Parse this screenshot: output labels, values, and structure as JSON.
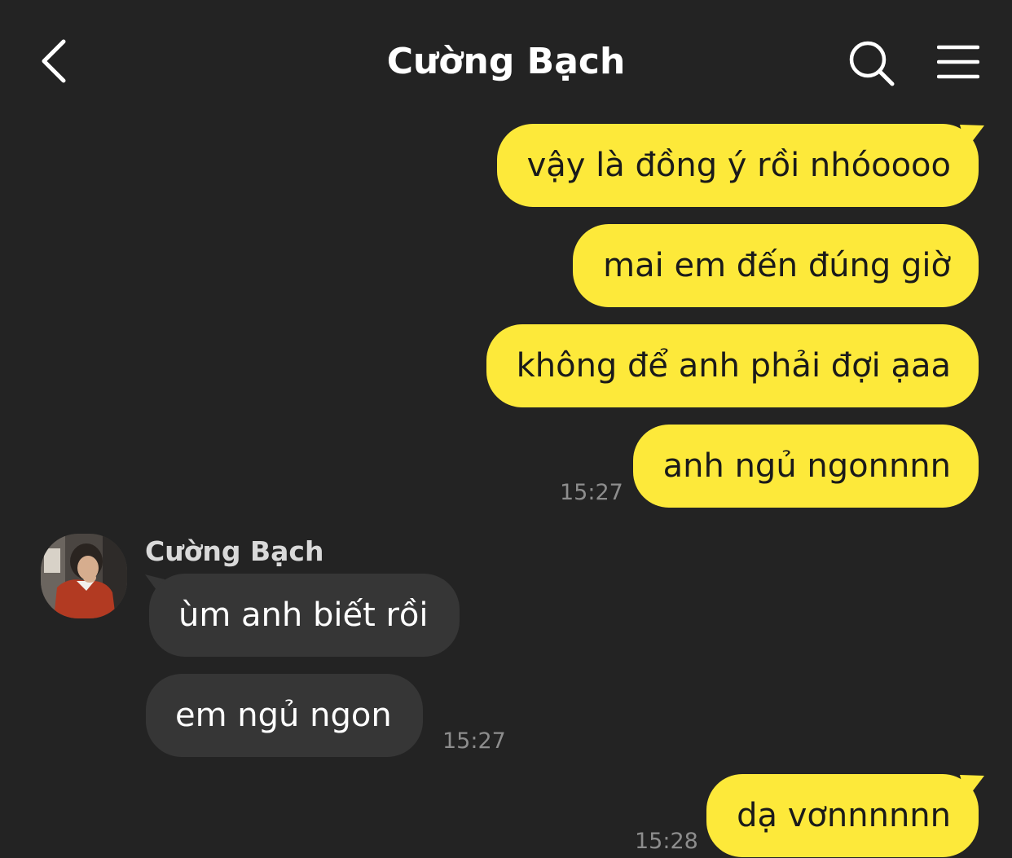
{
  "header": {
    "title": "Cường Bạch",
    "back_icon": "chevron-left-icon",
    "search_icon": "search-icon",
    "menu_icon": "hamburger-menu-icon"
  },
  "colors": {
    "background": "#232323",
    "outgoing_bubble": "#fde93a",
    "incoming_bubble": "#363636",
    "timestamp": "#8d8d8d"
  },
  "messages": [
    {
      "direction": "outgoing",
      "text": "vậy là đồng ý rồi nhóoooo"
    },
    {
      "direction": "outgoing",
      "text": "mai em đến đúng giờ"
    },
    {
      "direction": "outgoing",
      "text": "không để anh phải đợi ạaa"
    },
    {
      "direction": "outgoing",
      "text": "anh ngủ ngonnnn",
      "time": "15:27"
    },
    {
      "direction": "incoming",
      "sender": "Cường Bạch",
      "text": "ùm anh biết rồi"
    },
    {
      "direction": "incoming",
      "text": "em ngủ ngon",
      "time": "15:27"
    },
    {
      "direction": "outgoing",
      "text": "dạ vơnnnnnn",
      "time": "15:28"
    }
  ]
}
